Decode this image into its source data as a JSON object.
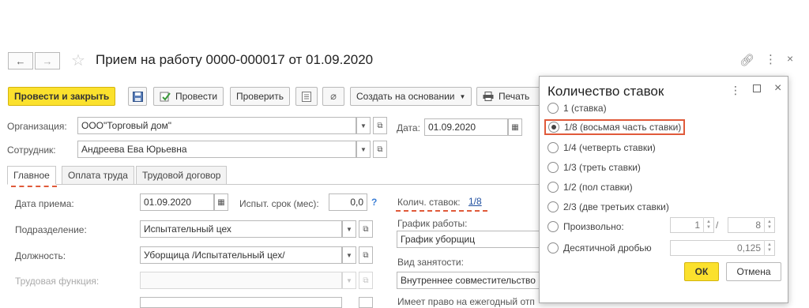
{
  "window": {
    "title": "Прием на работу 0000-000017 от 01.09.2020"
  },
  "toolbar": {
    "post_close": "Провести и закрыть",
    "post": "Провести",
    "check": "Проверить",
    "create_based": "Создать на основании",
    "print": "Печать"
  },
  "header": {
    "org_label": "Организация:",
    "org_value": "ООО\"Торговый дом\"",
    "date_label": "Дата:",
    "date_value": "01.09.2020",
    "employee_label": "Сотрудник:",
    "employee_value": "Андреева Ева Юрьевна"
  },
  "tabs": [
    "Главное",
    "Оплата труда",
    "Трудовой договор"
  ],
  "main": {
    "hire_date_label": "Дата приема:",
    "hire_date_value": "01.09.2020",
    "trial_label": "Испыт. срок (мес):",
    "trial_value": "0,0",
    "help": "?",
    "rate_count_label": "Колич. ставок:",
    "rate_count_value": "1/8",
    "department_label": "Подразделение:",
    "department_value": "Испытательный цех",
    "schedule_label": "График работы:",
    "schedule_value": "График уборщиц",
    "position_label": "Должность:",
    "position_value": "Уборщица /Испытательный цех/",
    "employment_label": "Вид занятости:",
    "employment_value": "Внутреннее совместительство",
    "function_label": "Трудовая функция:",
    "bottom_partial": "Имеет право на ежегодный отп"
  },
  "popup": {
    "title": "Количество ставок",
    "options": [
      "1 (ставка)",
      "1/8 (восьмая часть ставки)",
      "1/4 (четверть ставки)",
      "1/3 (треть ставки)",
      "1/2 (пол ставки)",
      "2/3 (две третьих ставки)",
      "Произвольно:",
      "Десятичной дробью"
    ],
    "selected_index": 1,
    "numerator": "1",
    "slash": "/",
    "denominator": "8",
    "decimal": "0,125",
    "ok": "ОК",
    "cancel": "Отмена"
  },
  "colors": {
    "accent_yellow": "#fbe12d",
    "highlight_red": "#e05a3a",
    "link_blue": "#1f4fa0"
  }
}
